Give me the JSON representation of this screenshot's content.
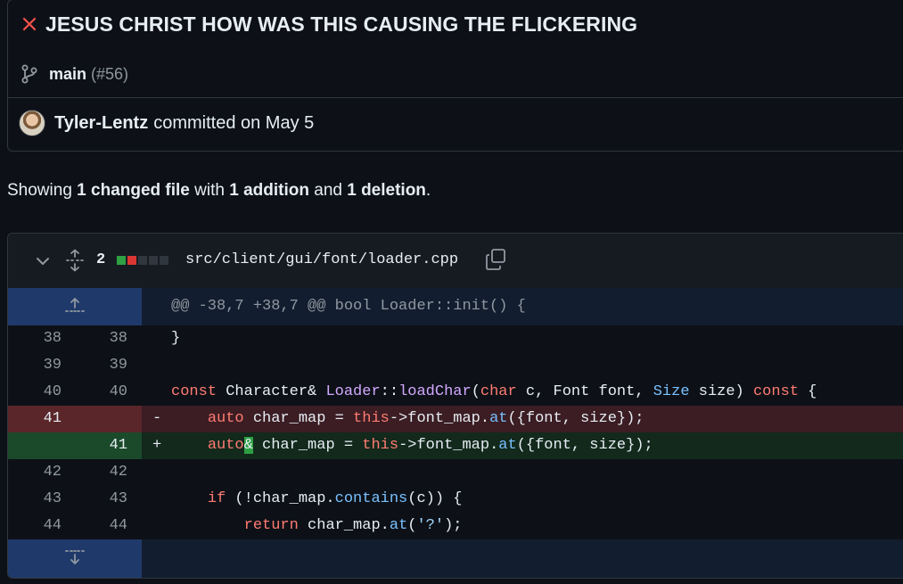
{
  "commit": {
    "title": "JESUS CHRIST HOW WAS THIS CAUSING THE FLICKERING",
    "status_color": "#f85149",
    "branch": "main",
    "pr_ref": "(#56)",
    "author": "Tyler-Lentz",
    "committed_text": "committed on May 5"
  },
  "summary": {
    "prefix": "Showing ",
    "files": "1 changed file",
    "with": " with ",
    "additions": "1 addition",
    "and": " and ",
    "deletions": "1 deletion",
    "suffix": "."
  },
  "file": {
    "change_count": "2",
    "diffstat_colors": [
      "#2ea043",
      "#da3633",
      "#30363d",
      "#30363d",
      "#30363d"
    ],
    "path": "src/client/gui/font/loader.cpp",
    "hunk_header": "@@ -38,7 +38,7 @@ bool Loader::init() {",
    "lines": [
      {
        "old": "38",
        "new": "38",
        "sign": "",
        "code": "}"
      },
      {
        "old": "39",
        "new": "39",
        "sign": "",
        "code": ""
      },
      {
        "old": "40",
        "new": "40",
        "sign": "",
        "code": "const Character& Loader::loadChar(char c, Font font, Size size) const {"
      },
      {
        "old": "41",
        "new": "",
        "sign": "-",
        "code": "    auto char_map = this->font_map.at({font, size});"
      },
      {
        "old": "",
        "new": "41",
        "sign": "+",
        "code": "    auto& char_map = this->font_map.at({font, size});"
      },
      {
        "old": "42",
        "new": "42",
        "sign": "",
        "code": ""
      },
      {
        "old": "43",
        "new": "43",
        "sign": "",
        "code": "    if (!char_map.contains(c)) {"
      },
      {
        "old": "44",
        "new": "44",
        "sign": "",
        "code": "        return char_map.at('?');"
      }
    ]
  },
  "icons": {
    "status": "x-icon",
    "branch": "git-branch-icon",
    "collapse": "chevron-down-icon",
    "expand": "unfold-icon",
    "copy": "copy-icon",
    "expand_up": "expand-up-icon",
    "expand_down": "expand-down-icon"
  }
}
